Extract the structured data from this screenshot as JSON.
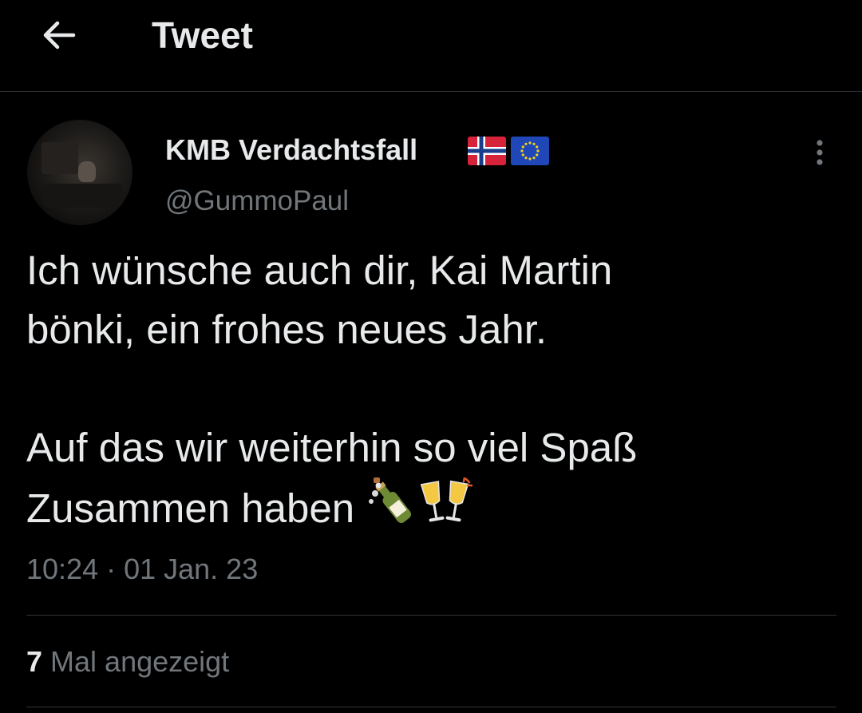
{
  "header": {
    "back_icon": "arrow-left-icon",
    "title": "Tweet"
  },
  "author": {
    "display_name": "KMB Verdachtsfall",
    "flags": [
      "norway-flag",
      "eu-flag"
    ],
    "handle": "@GummoPaul",
    "more_icon": "more-vertical-icon"
  },
  "tweet": {
    "line1": "Ich wünsche auch dir, Kai Martin",
    "line2": "bönki, ein frohes neues Jahr.",
    "line3": "Auf das wir weiterhin so viel Spaß",
    "line4": "Zusammen haben",
    "emojis": [
      "bottle-with-popping-cork",
      "clinking-glasses"
    ],
    "timestamp": "10:24 · 01 Jan. 23"
  },
  "stats": {
    "views_count": "7",
    "views_label": "Mal angezeigt"
  },
  "colors": {
    "background": "#000000",
    "text_primary": "#e7e9ea",
    "text_secondary": "#71767b",
    "divider": "#2f3336"
  }
}
